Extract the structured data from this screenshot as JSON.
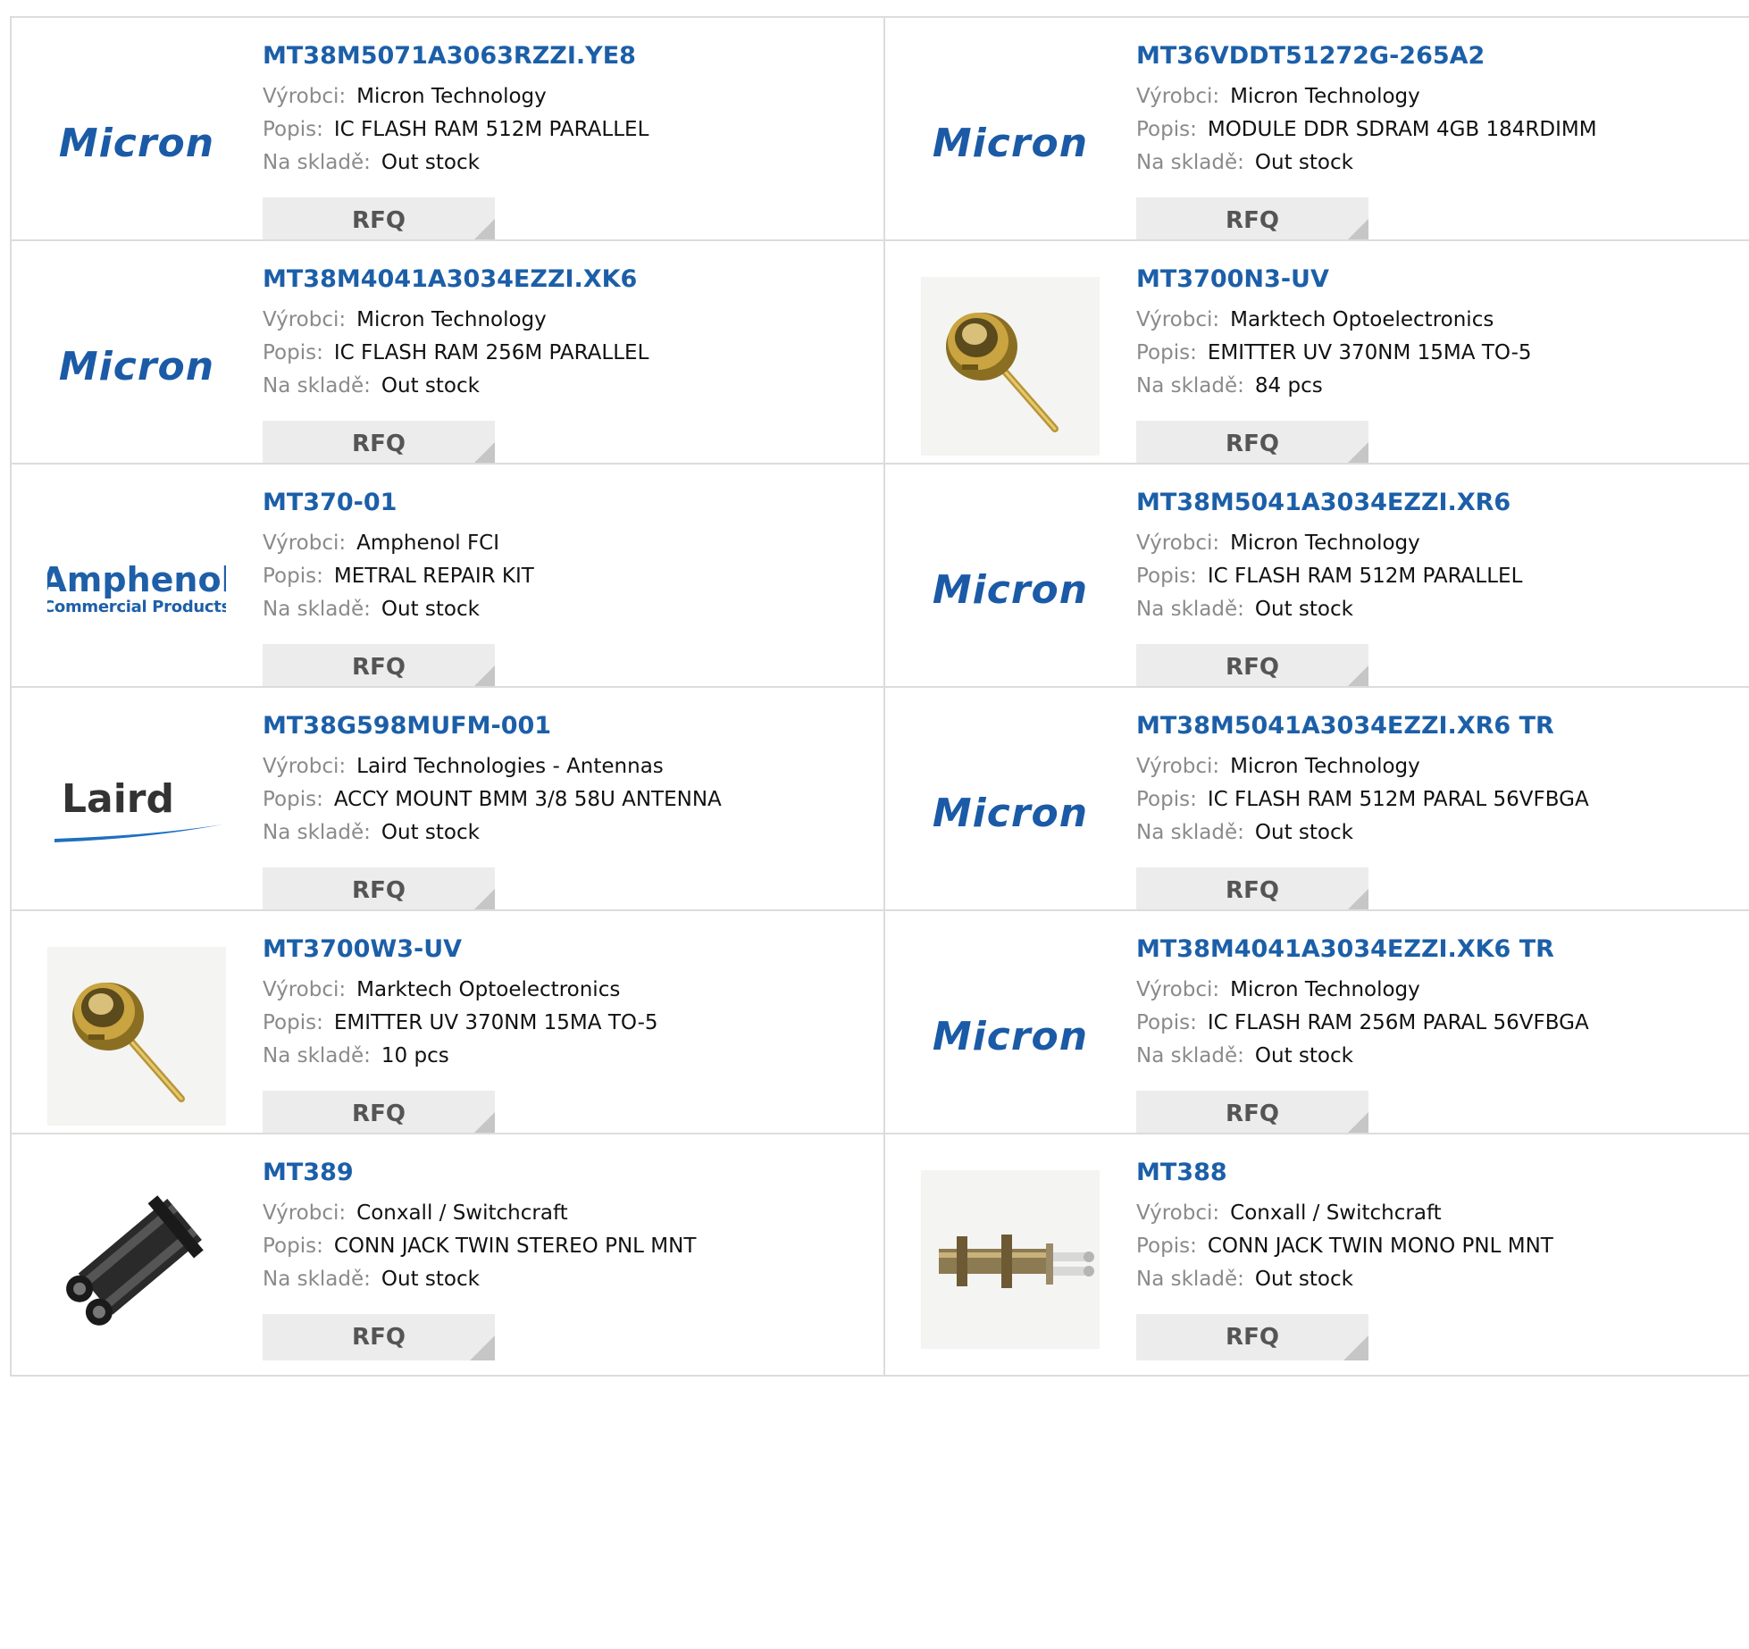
{
  "labels": {
    "manufacturer": "Výrobci:",
    "description": "Popis:",
    "stock": "Na skladě:",
    "rfq": "RFQ"
  },
  "colors": {
    "link": "#1c5fa8",
    "label": "#8a8a8a",
    "border": "#dcdcdc",
    "button_bg": "#ececec"
  },
  "logos": {
    "micron": "Micron",
    "amphenol_top": "Amphenol",
    "amphenol_bottom": "Commercial Products",
    "laird": "Laird"
  },
  "products": [
    {
      "part": "MT38M5071A3063RZZI.YE8",
      "manufacturer": "Micron Technology",
      "description": "IC FLASH RAM 512M PARALLEL",
      "stock": "Out stock",
      "image": "micron-logo"
    },
    {
      "part": "MT36VDDT51272G-265A2",
      "manufacturer": "Micron Technology",
      "description": "MODULE DDR SDRAM 4GB 184RDIMM",
      "stock": "Out stock",
      "image": "micron-logo"
    },
    {
      "part": "MT38M4041A3034EZZI.XK6",
      "manufacturer": "Micron Technology",
      "description": "IC FLASH RAM 256M PARALLEL",
      "stock": "Out stock",
      "image": "micron-logo"
    },
    {
      "part": "MT3700N3-UV",
      "manufacturer": "Marktech Optoelectronics",
      "description": "EMITTER UV 370NM 15MA TO-5",
      "stock": "84 pcs",
      "image": "to5-emitter-photo"
    },
    {
      "part": "MT370-01",
      "manufacturer": "Amphenol FCI",
      "description": "METRAL REPAIR KIT",
      "stock": "Out stock",
      "image": "amphenol-logo"
    },
    {
      "part": "MT38M5041A3034EZZI.XR6",
      "manufacturer": "Micron Technology",
      "description": "IC FLASH RAM 512M PARALLEL",
      "stock": "Out stock",
      "image": "micron-logo"
    },
    {
      "part": "MT38G598MUFM-001",
      "manufacturer": "Laird Technologies - Antennas",
      "description": "ACCY MOUNT BMM 3/8 58U ANTENNA",
      "stock": "Out stock",
      "image": "laird-logo"
    },
    {
      "part": "MT38M5041A3034EZZI.XR6 TR",
      "manufacturer": "Micron Technology",
      "description": "IC FLASH RAM 512M PARAL 56VFBGA",
      "stock": "Out stock",
      "image": "micron-logo"
    },
    {
      "part": "MT3700W3-UV",
      "manufacturer": "Marktech Optoelectronics",
      "description": "EMITTER UV 370NM 15MA TO-5",
      "stock": "10 pcs",
      "image": "to5-emitter-photo"
    },
    {
      "part": "MT38M4041A3034EZZI.XK6 TR",
      "manufacturer": "Micron Technology",
      "description": "IC FLASH RAM 256M PARAL 56VFBGA",
      "stock": "Out stock",
      "image": "micron-logo"
    },
    {
      "part": "MT389",
      "manufacturer": "Conxall / Switchcraft",
      "description": "CONN JACK TWIN STEREO PNL MNT",
      "stock": "Out stock",
      "image": "twin-jack-stereo-photo"
    },
    {
      "part": "MT388",
      "manufacturer": "Conxall / Switchcraft",
      "description": "CONN JACK TWIN MONO PNL MNT",
      "stock": "Out stock",
      "image": "twin-jack-mono-photo"
    }
  ]
}
